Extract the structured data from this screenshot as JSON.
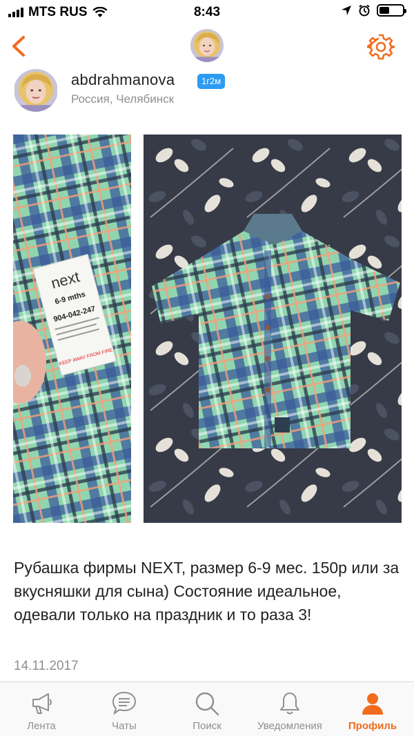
{
  "status_bar": {
    "carrier": "MTS RUS",
    "time": "8:43"
  },
  "colors": {
    "accent": "#f26b1d",
    "badge": "#2d9bf0",
    "secondary_text": "#8e8e93"
  },
  "nav": {
    "back_icon": "chevron-left-icon",
    "settings_icon": "gear-icon"
  },
  "post": {
    "username": "abdrahmanova",
    "badge": "1г2м",
    "location": "Россия, Челябинск",
    "description": "Рубашка фирмы NEXT, размер 6-9 мес. 150р или за вкусняшки для сына) Состояние идеальное, одевали только на праздник и то раза 3!",
    "date": "14.11.2017"
  },
  "photos": {
    "label_brand": "next",
    "label_size": "6-9 mths",
    "label_code": "904-042-247",
    "label_warning": "KEEP AWAY FROM FIRE"
  },
  "tabs": [
    {
      "label": "Лента",
      "icon": "megaphone-icon",
      "active": false
    },
    {
      "label": "Чаты",
      "icon": "chat-bubble-icon",
      "active": false
    },
    {
      "label": "Поиск",
      "icon": "search-icon",
      "active": false
    },
    {
      "label": "Уведомления",
      "icon": "bell-icon",
      "active": false
    },
    {
      "label": "Профиль",
      "icon": "profile-icon",
      "active": true
    }
  ]
}
